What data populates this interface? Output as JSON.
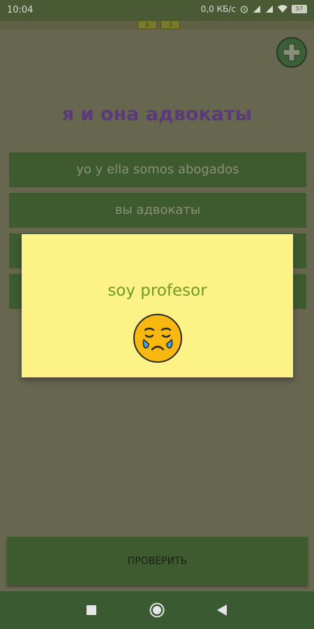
{
  "status_bar": {
    "time": "10:04",
    "network_speed": "0,0 КБ/с",
    "battery": "57"
  },
  "counters": {
    "correct": "0",
    "wrong": "3"
  },
  "question": "я и она адвокаты",
  "options": [
    "yo y ella somos abogados",
    "вы адвокаты",
    "",
    ""
  ],
  "dialog": {
    "text": "soy profesor",
    "icon": "crying-face-icon"
  },
  "check_button_label": "ПРОВЕРИТЬ",
  "colors": {
    "background": "#67664f",
    "option_bg": "#3e5b30",
    "dialog_bg": "#fdf285",
    "question_text": "#5a3a7a",
    "dialog_text": "#6f9b2a"
  }
}
